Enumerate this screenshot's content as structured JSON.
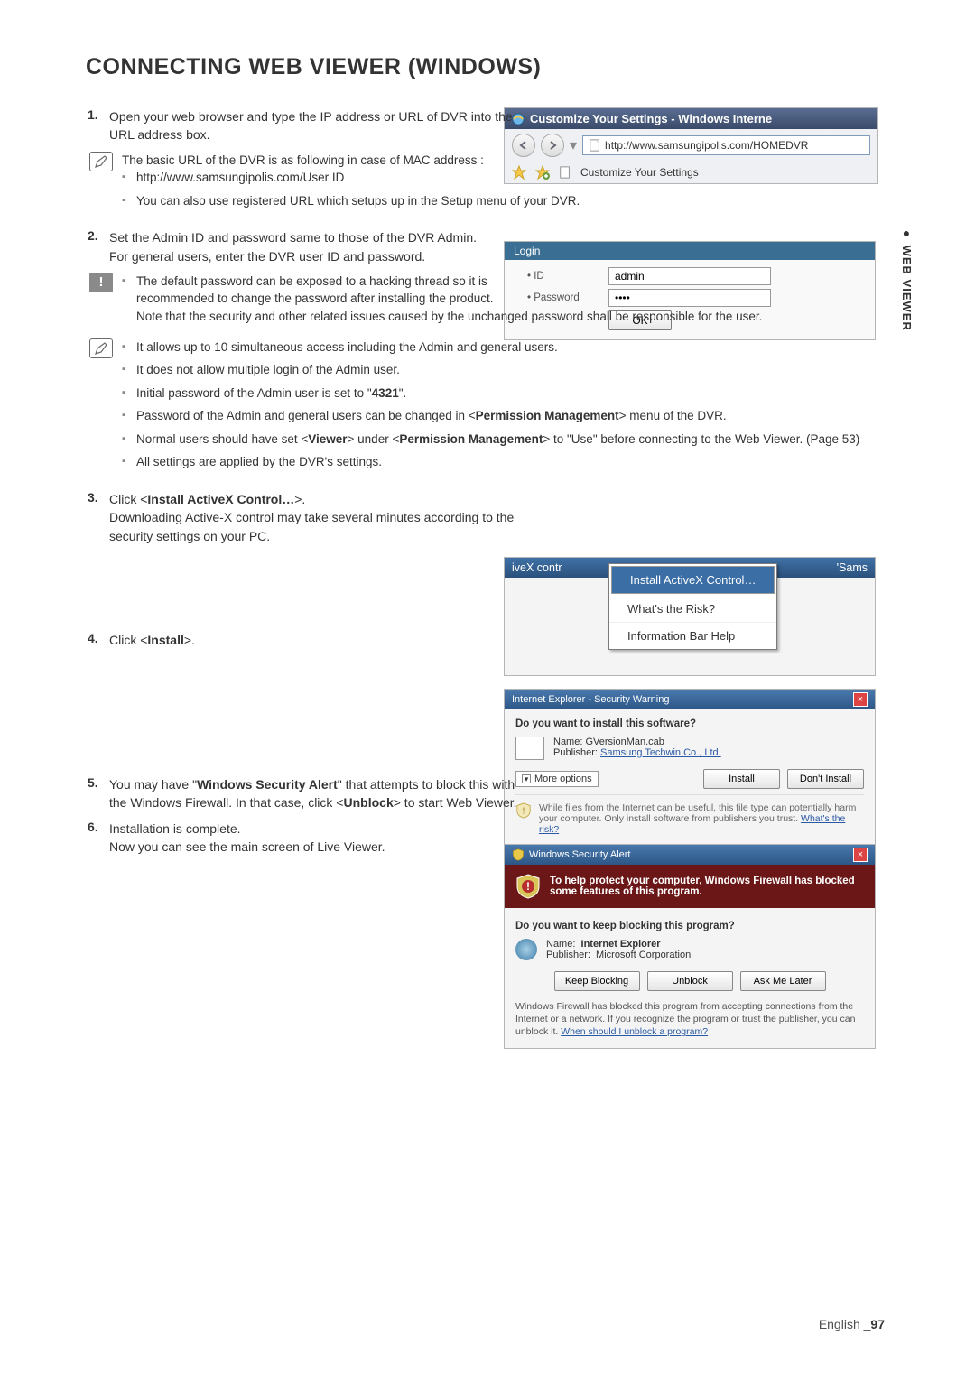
{
  "sideTab": {
    "label": " WEB VIEWER"
  },
  "heading": "CONNECTING WEB VIEWER (WINDOWS)",
  "step1": {
    "num": "1.",
    "text": "Open your web browser and type the IP address or URL of DVR into the URL address box."
  },
  "note1": {
    "intro": "The basic URL of the DVR is as following in case of MAC address :",
    "bullets": [
      "http://www.samsungipolis.com/User ID",
      "You can also use registered URL which setups up in the Setup menu of your DVR."
    ]
  },
  "step2": {
    "num": "2.",
    "line1": "Set the Admin ID and password same to those of the DVR Admin.",
    "line2": "For general users, enter the DVR user ID and password."
  },
  "warn1": {
    "line1": "The default password can be exposed to a hacking thread so it is recommended to change the password after installing the product.",
    "line2": "Note that the security and other related issues caused by the unchanged password shall be responsible for the user."
  },
  "note2": {
    "bullets": {
      "b0": "It allows up to 10 simultaneous access including the Admin and general users.",
      "b1": "It does not allow multiple login of the Admin user.",
      "b2_pre": "Initial password of the Admin user is set to \"",
      "b2_bold": "4321",
      "b2_post": "\".",
      "b3_pre": "Password of the Admin and general users can be changed in <",
      "b3_bold": "Permission Management",
      "b3_post": "> menu of the DVR.",
      "b4_pre": "Normal users should have set <",
      "b4_b1": "Viewer",
      "b4_mid": "> under <",
      "b4_b2": "Permission Management",
      "b4_post": "> to \"Use\" before connecting to the Web Viewer. (Page 53)",
      "b5": "All settings are applied by the DVR's settings."
    }
  },
  "step3": {
    "num": "3.",
    "pre": "Click <",
    "bold": "Install ActiveX Control…",
    "post": ">.",
    "line2": "Downloading Active-X control may take several minutes according to the security settings on your PC."
  },
  "step4": {
    "num": "4.",
    "pre": "Click <",
    "bold": "Install",
    "post": ">."
  },
  "step5": {
    "num": "5.",
    "pre": "You may have \"",
    "bold1": "Windows Security Alert",
    "mid": "\" that attempts to block this with the Windows Firewall. In that case, click <",
    "bold2": "Unblock",
    "post": "> to start Web Viewer."
  },
  "step6": {
    "num": "6.",
    "line1": "Installation is complete.",
    "line2": "Now you can see the main screen of Live Viewer."
  },
  "browser": {
    "title": "Customize Your Settings - Windows Interne",
    "url": "http://www.samsungipolis.com/HOMEDVR",
    "tab": "Customize Your Settings"
  },
  "login": {
    "title": "Login",
    "idLabel": "• ID",
    "idValue": "admin",
    "pwLabel": "• Password",
    "pwValue": "••••",
    "ok": "OK"
  },
  "activex": {
    "leftText": "iveX contr",
    "rightText": "'Sams",
    "m1": "Install ActiveX Control…",
    "m2": "What's the Risk?",
    "m3": "Information Bar Help"
  },
  "secDialog": {
    "title": "Internet Explorer - Security Warning",
    "q": "Do you want to install this software?",
    "nameLbl": "Name:",
    "nameVal": "GVersionMan.cab",
    "pubLbl": "Publisher:",
    "pubVal": "Samsung Techwin Co., Ltd.",
    "more": "More options",
    "install": "Install",
    "dont": "Don't Install",
    "warnPre": "While files from the Internet can be useful, this file type can potentially harm your computer. Only install software from publishers you trust. ",
    "warnLink": "What's the risk?"
  },
  "fwDialog": {
    "title": "Windows Security Alert",
    "banner": "To help protect your computer, Windows Firewall has blocked some features of this program.",
    "q": "Do you want to keep blocking this program?",
    "nameLbl": "Name:",
    "nameVal": "Internet Explorer",
    "pubLbl": "Publisher:",
    "pubVal": "Microsoft Corporation",
    "keep": "Keep Blocking",
    "unblock": "Unblock",
    "ask": "Ask Me Later",
    "footPre": "Windows Firewall has blocked this program from accepting connections from the Internet or a network. If you recognize the program or trust the publisher, you can unblock it. ",
    "footLink": "When should I unblock a program?"
  },
  "footer": {
    "lang": "English ",
    "sep": "_",
    "page": "97"
  }
}
